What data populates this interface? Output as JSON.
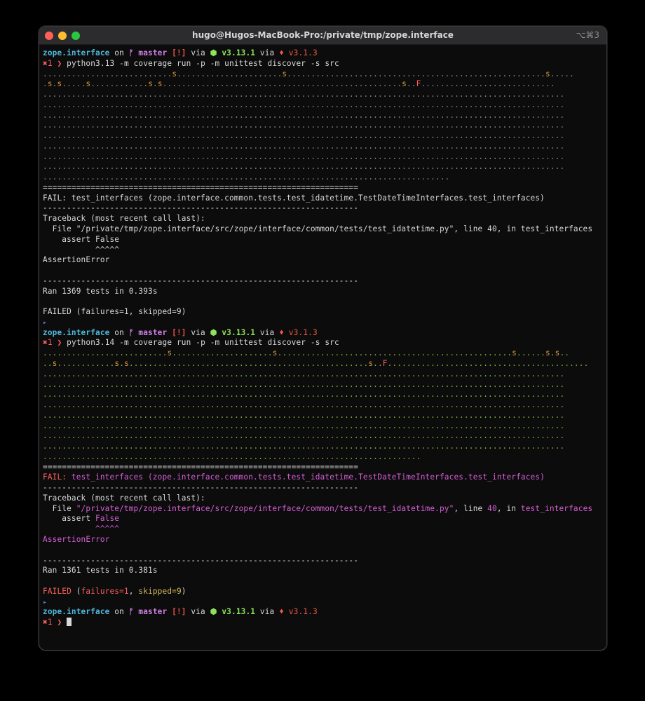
{
  "window": {
    "title": "hugo@Hugos-MacBook-Pro:/private/tmp/zope.interface",
    "shortcut": "⌥⌘3"
  },
  "prompt": {
    "dir": "zope.interface",
    "on": " on ",
    "branch_icon": "ᚠ",
    "branch": "master",
    "status": "[!]",
    "via": " via ",
    "node_icon": "⬢",
    "node_version": "v3.13.1",
    "ruby_icon": "♦",
    "ruby_version": "v3.1.3",
    "error_mark": "✖",
    "exit_code": "1",
    "chevron": "❯"
  },
  "run1": {
    "command": "python3.13 -m coverage run -p -m unittest discover -s src",
    "dots": [
      "...........................s......................s......................................................s.....",
      ".s.s.....s............s.s..................................................s..F............................",
      ".............................................................................................................",
      ".............................................................................................................",
      ".............................................................................................................",
      ".............................................................................................................",
      ".............................................................................................................",
      ".............................................................................................................",
      ".............................................................................................................",
      ".............................................................................................................",
      "....................................................................................."
    ],
    "separator_eq": "==================================================================",
    "fail_header": "FAIL: test_interfaces (zope.interface.common.tests.test_idatetime.TestDateTimeInterfaces.test_interfaces)",
    "separator_dash": "------------------------------------------------------------------",
    "traceback": "Traceback (most recent call last):",
    "file_line": "  File \"/private/tmp/zope.interface/src/zope/interface/common/tests/test_idatetime.py\", line 40, in test_interfaces",
    "assert_line": "    assert False",
    "caret_line": "           ^^^^^",
    "error": "AssertionError",
    "ran": "Ran 1369 tests in 0.393s",
    "result": "FAILED (failures=1, skipped=9)"
  },
  "run2": {
    "command": "python3.14 -m coverage run -p -m unittest discover -s src",
    "dots": [
      "..........................s.....................s.................................................s......s.s..",
      "..s............s.s..................................................s..F..........................................",
      ".............................................................................................................",
      ".............................................................................................................",
      ".............................................................................................................",
      ".............................................................................................................",
      ".............................................................................................................",
      ".............................................................................................................",
      ".............................................................................................................",
      ".............................................................................................................",
      "..............................................................................."
    ],
    "separator_eq": "==================================================================",
    "fail_word": "FAIL:",
    "fail_rest": " test_interfaces (zope.interface.common.tests.test_idatetime.TestDateTimeInterfaces.test_interfaces)",
    "separator_dash": "------------------------------------------------------------------",
    "traceback": "Traceback (most recent call last):",
    "file_prefix": "  File ",
    "file_path": "\"/private/tmp/zope.interface/src/zope/interface/common/tests/test_idatetime.py\"",
    "line_word": ", line ",
    "line_no": "40",
    "in_word": ", in ",
    "func": "test_interfaces",
    "assert_prefix": "    assert ",
    "assert_value": "False",
    "caret_line": "           ^^^^^",
    "error": "AssertionError",
    "ran": "Ran 1361 tests in 0.381s",
    "result_word": "FAILED",
    "result_open": " (",
    "failures": "failures=1",
    "comma": ", ",
    "skipped": "skipped=9",
    "result_close": ")"
  },
  "colors": {
    "background": "#0c0c0c",
    "text": "#d8d8d8",
    "fail_red": "#ff5f5f",
    "magenta": "#d65fd6",
    "dots_green": "#7fb83f"
  }
}
